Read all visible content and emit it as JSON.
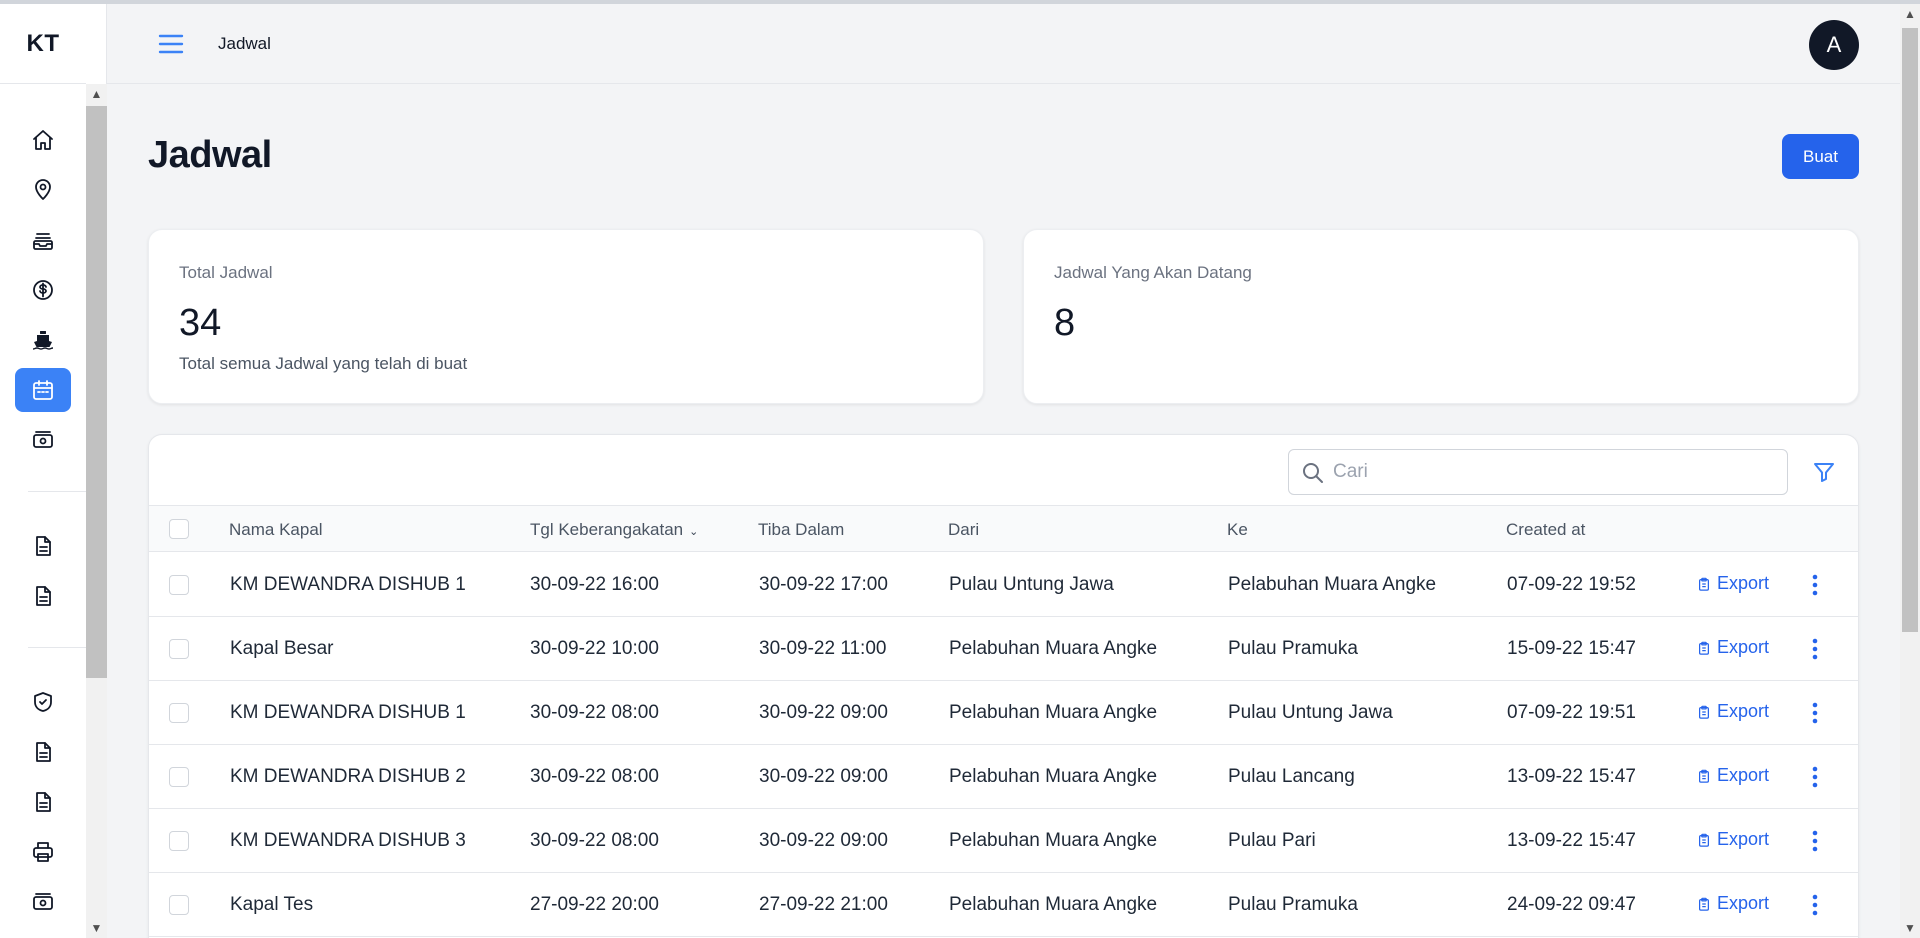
{
  "brand": "KT",
  "breadcrumb": "Jadwal",
  "avatar_initial": "A",
  "page": {
    "title": "Jadwal",
    "create_label": "Buat"
  },
  "stats": [
    {
      "label": "Total Jadwal",
      "value": "34",
      "description": "Total semua Jadwal yang telah di buat"
    },
    {
      "label": "Jadwal Yang Akan Datang",
      "value": "8",
      "description": ""
    }
  ],
  "search": {
    "placeholder": "Cari",
    "value": ""
  },
  "table": {
    "columns": [
      "Nama Kapal",
      "Tgl Keberangakatan",
      "Tiba Dalam",
      "Dari",
      "Ke",
      "Created at"
    ],
    "sorted_column": "Tgl Keberangakatan",
    "export_label": "Export",
    "rows": [
      {
        "kapal": "KM DEWANDRA DISHUB 1",
        "berangkat": "30-09-22 16:00",
        "tiba": "30-09-22 17:00",
        "dari": "Pulau Untung Jawa",
        "ke": "Pelabuhan Muara Angke",
        "created": "07-09-22 19:52"
      },
      {
        "kapal": "Kapal Besar",
        "berangkat": "30-09-22 10:00",
        "tiba": "30-09-22 11:00",
        "dari": "Pelabuhan Muara Angke",
        "ke": "Pulau Pramuka",
        "created": "15-09-22 15:47"
      },
      {
        "kapal": "KM DEWANDRA DISHUB 1",
        "berangkat": "30-09-22 08:00",
        "tiba": "30-09-22 09:00",
        "dari": "Pelabuhan Muara Angke",
        "ke": "Pulau Untung Jawa",
        "created": "07-09-22 19:51"
      },
      {
        "kapal": "KM DEWANDRA DISHUB 2",
        "berangkat": "30-09-22 08:00",
        "tiba": "30-09-22 09:00",
        "dari": "Pelabuhan Muara Angke",
        "ke": "Pulau Lancang",
        "created": "13-09-22 15:47"
      },
      {
        "kapal": "KM DEWANDRA DISHUB 3",
        "berangkat": "30-09-22 08:00",
        "tiba": "30-09-22 09:00",
        "dari": "Pelabuhan Muara Angke",
        "ke": "Pulau Pari",
        "created": "13-09-22 15:47"
      },
      {
        "kapal": "Kapal Tes",
        "berangkat": "27-09-22 20:00",
        "tiba": "27-09-22 21:00",
        "dari": "Pelabuhan Muara Angke",
        "ke": "Pulau Pramuka",
        "created": "24-09-22 09:47"
      }
    ]
  },
  "sidebar": {
    "items": [
      {
        "icon": "home-icon",
        "active": false
      },
      {
        "icon": "location-pin-icon",
        "active": false
      },
      {
        "icon": "inbox-stack-icon",
        "active": false
      },
      {
        "icon": "dollar-circle-icon",
        "active": false
      },
      {
        "icon": "ship-icon",
        "active": false
      },
      {
        "icon": "calendar-icon",
        "active": true
      },
      {
        "icon": "cash-icon",
        "active": false
      },
      {
        "icon": "document-icon",
        "active": false
      },
      {
        "icon": "document-icon",
        "active": false
      },
      {
        "icon": "shield-check-icon",
        "active": false
      },
      {
        "icon": "document-icon",
        "active": false
      },
      {
        "icon": "document-icon",
        "active": false
      },
      {
        "icon": "printer-icon",
        "active": false
      },
      {
        "icon": "cash-icon",
        "active": false
      }
    ]
  },
  "colors": {
    "accent": "#2563eb",
    "active_nav": "#3b82f6",
    "background": "#f3f4f6"
  }
}
